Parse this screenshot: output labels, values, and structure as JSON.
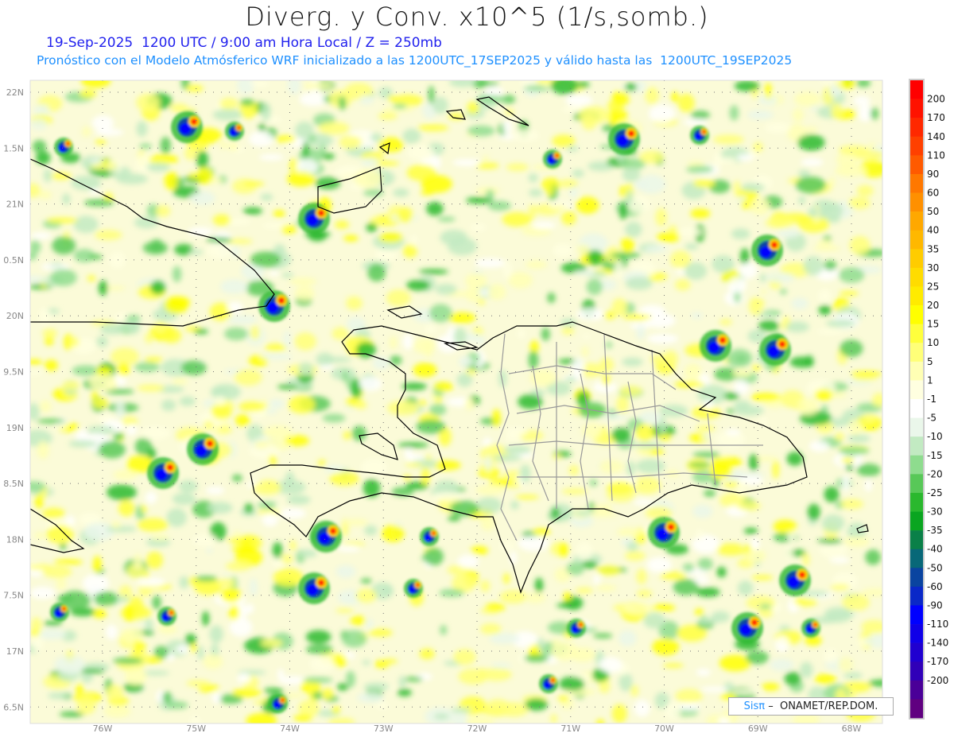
{
  "header": {
    "title": "Diverg. y Conv. x10^5 (1/s,somb.)",
    "subtitle": "19-Sep-2025  1200 UTC / 9:00 am Hora Local / Z = 250mb",
    "forecast_info": "Pronóstico con el Modelo Atmósferico WRF inicializado a las 1200UTC_17SEP2025 y válido hasta las  1200UTC_19SEP2025"
  },
  "map": {
    "lat_labels": [
      "22N",
      "1.5N",
      "21N",
      "0.5N",
      "20N",
      "9.5N",
      "19N",
      "8.5N",
      "18N",
      "7.5N",
      "17N",
      "6.5N"
    ],
    "lon_labels": [
      "76W",
      "75W",
      "74W",
      "73W",
      "72W",
      "71W",
      "70W",
      "69W",
      "68W"
    ]
  },
  "legend": {
    "labels": [
      "200",
      "170",
      "140",
      "110",
      "90",
      "60",
      "50",
      "40",
      "35",
      "30",
      "25",
      "20",
      "15",
      "10",
      "5",
      "1",
      "-1",
      "-5",
      "-10",
      "-15",
      "-20",
      "-25",
      "-30",
      "-35",
      "-40",
      "-50",
      "-60",
      "-90",
      "-110",
      "-140",
      "-170",
      "-200"
    ],
    "colors": [
      "#ff0000",
      "#ff1200",
      "#ff2800",
      "#ff4000",
      "#ff5a00",
      "#ff7800",
      "#ff9000",
      "#ffa800",
      "#ffb800",
      "#ffcc00",
      "#ffdc00",
      "#ffeb00",
      "#ffff00",
      "#ffff3c",
      "#ffff78",
      "#ffffb4",
      "#ffffe0",
      "#ffffff",
      "#eaf7ea",
      "#c2eac2",
      "#8edc8e",
      "#58c858",
      "#2ab82e",
      "#0aa520",
      "#0a8048",
      "#086878",
      "#0a44a0",
      "#0a28c8",
      "#0000ff",
      "#1000e8",
      "#2000d0",
      "#3000b8",
      "#4a0098",
      "#600080"
    ]
  },
  "credit": {
    "brand": "Sisπ",
    "text": " –  ONAMET/REP.DOM."
  }
}
